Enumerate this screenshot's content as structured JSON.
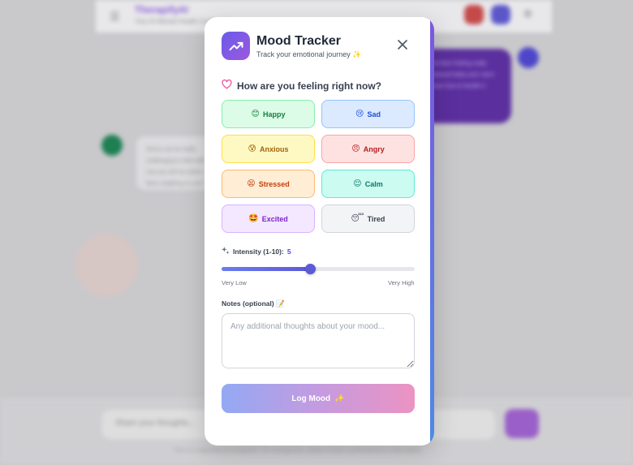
{
  "background": {
    "app_name": "TherapifyAI",
    "tagline": "Your AI Mental Health Companion",
    "user_message": "I've been feeling really stressed lately and I don't know how to handle it.",
    "bot_message": "Stress can be really challenging to deal with. Can you tell me what's been weighing on you?",
    "input_placeholder": "Share your thoughts...",
    "footer_text": "This is a supportive AI companion. For emergencies, please contact a professional or crisis hotline."
  },
  "modal": {
    "title": "Mood Tracker",
    "subtitle": "Track your emotional journey ✨",
    "header_icon": "trending-up-icon",
    "close_icon": "close-icon",
    "question": "How are you feeling right now?",
    "question_icon": "heart-icon",
    "moods": [
      {
        "label": "Happy",
        "emoji": "😊",
        "bg": "#dcfce7",
        "border": "#86efac",
        "color": "#15803d"
      },
      {
        "label": "Sad",
        "emoji": "😢",
        "bg": "#dbeafe",
        "border": "#93c5fd",
        "color": "#1d4ed8"
      },
      {
        "label": "Anxious",
        "emoji": "😰",
        "bg": "#fef9c3",
        "border": "#fde047",
        "color": "#a16207"
      },
      {
        "label": "Angry",
        "emoji": "😠",
        "bg": "#fee2e2",
        "border": "#fca5a5",
        "color": "#b91c1c"
      },
      {
        "label": "Stressed",
        "emoji": "😫",
        "bg": "#ffedd5",
        "border": "#fdba74",
        "color": "#c2410c"
      },
      {
        "label": "Calm",
        "emoji": "😌",
        "bg": "#ccfbf1",
        "border": "#5eead4",
        "color": "#0f766e"
      },
      {
        "label": "Excited",
        "emoji": "🤩",
        "bg": "#f3e8ff",
        "border": "#d8b4fe",
        "color": "#7e22ce"
      },
      {
        "label": "Tired",
        "emoji": "😴",
        "bg": "#f3f4f6",
        "border": "#d1d5db",
        "color": "#374151"
      }
    ],
    "intensity_label": "Intensity (1-10):",
    "intensity_icon": "sparkles-icon",
    "intensity_value": "5",
    "intensity_min": 1,
    "intensity_max": 10,
    "scale_low": "Very Low",
    "scale_high": "Very High",
    "notes_label": "Notes (optional) 📝",
    "notes_placeholder": "Any additional thoughts about your mood...",
    "notes_value": "",
    "log_button": "Log Mood",
    "log_button_icon": "sparkle-icon"
  },
  "colors": {
    "accent": "#4f46e5",
    "modal_edge": "#7b57e0"
  }
}
